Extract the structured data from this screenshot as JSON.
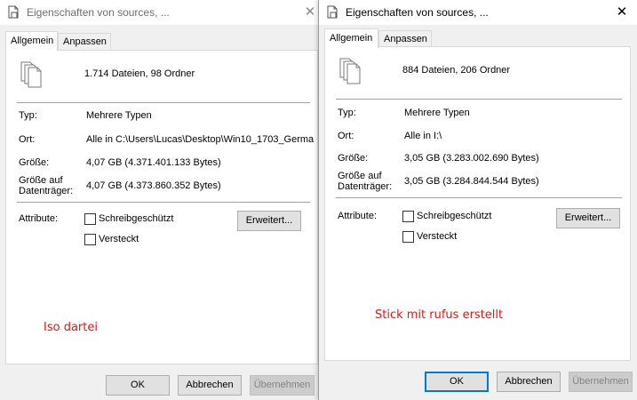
{
  "left": {
    "title": "Eigenschaften von sources, ...",
    "close_glyph": "✕",
    "tabs": [
      {
        "label": "Allgemein"
      },
      {
        "label": "Anpassen"
      }
    ],
    "count": "1.714 Dateien, 98 Ordner",
    "type_label": "Typ:",
    "type_value": "Mehrere Typen",
    "location_label": "Ort:",
    "location_value": "Alle in C:\\Users\\Lucas\\Desktop\\Win10_1703_Germa",
    "size_label": "Größe:",
    "size_value": "4,07 GB (4.371.401.133 Bytes)",
    "disk_label_1": "Größe auf",
    "disk_label_2": "Datenträger:",
    "disk_value": "4,07 GB (4.373.860.352 Bytes)",
    "attributes_label": "Attribute:",
    "readonly_label": "Schreibgeschützt",
    "hidden_label": "Versteckt",
    "advanced_label": "Erweitert...",
    "annotation": "Iso dartei",
    "ok_label": "OK",
    "cancel_label": "Abbrechen",
    "apply_label": "Übernehmen"
  },
  "right": {
    "title": "Eigenschaften von sources, ...",
    "close_glyph": "✕",
    "tabs": [
      {
        "label": "Allgemein"
      },
      {
        "label": "Anpassen"
      }
    ],
    "count": "884 Dateien, 206 Ordner",
    "type_label": "Typ:",
    "type_value": "Mehrere Typen",
    "location_label": "Ort:",
    "location_value": "Alle in I:\\",
    "size_label": "Größe:",
    "size_value": "3,05 GB (3.283.002.690 Bytes)",
    "disk_label_1": "Größe auf",
    "disk_label_2": "Datenträger:",
    "disk_value": "3,05 GB (3.284.844.544 Bytes)",
    "attributes_label": "Attribute:",
    "readonly_label": "Schreibgeschützt",
    "hidden_label": "Versteckt",
    "advanced_label": "Erweitert...",
    "annotation": "Stick mit rufus erstellt",
    "ok_label": "OK",
    "cancel_label": "Abbrechen",
    "apply_label": "Übernehmen"
  },
  "icons": {
    "title": "properties-document-icon",
    "files": "multiple-files-icon",
    "close": "close-icon"
  },
  "colors": {
    "annotation": "#e81010",
    "default_button_border": "#0078d7",
    "dialog_background": "#f0f0f0",
    "panel_background": "#ffffff"
  }
}
